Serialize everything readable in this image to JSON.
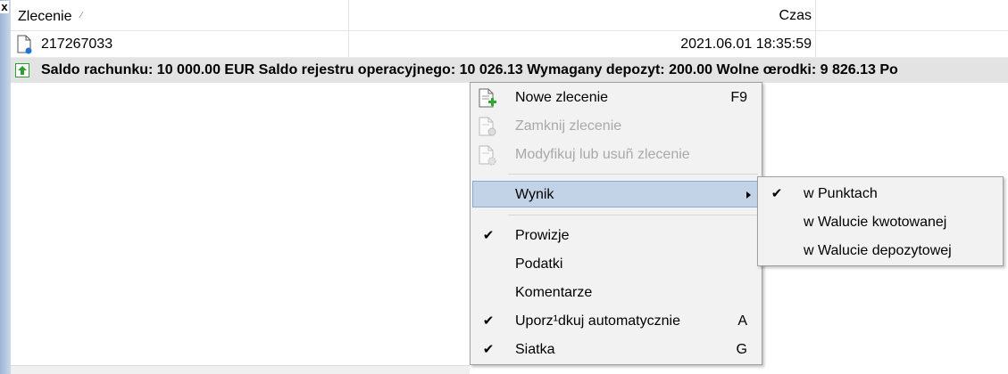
{
  "window": {
    "close_glyph": "x"
  },
  "table": {
    "columns": [
      {
        "label": "Zlecenie",
        "sort_indicator": "⁄"
      },
      {
        "label": "Czas"
      }
    ],
    "rows": [
      {
        "order": "217267033",
        "time": "2021.06.01 18:35:59",
        "icon": "order-document-icon"
      }
    ],
    "summary": {
      "icon": "green-up-arrow-icon",
      "text": "Saldo rachunku: 10 000.00 EUR  Saldo rejestru operacyjnego: 10 026.13  Wymagany depozyt: 200.00  Wolne œrodki: 9 826.13  Po"
    }
  },
  "context_menu": {
    "items": [
      {
        "label": "Nowe zlecenie",
        "shortcut": "F9",
        "icon": "new-order-icon",
        "enabled": true
      },
      {
        "label": "Zamknij zlecenie",
        "shortcut": "",
        "icon": "close-order-icon",
        "enabled": false
      },
      {
        "label": "Modyfikuj lub usuñ zlecenie",
        "shortcut": "",
        "icon": "modify-order-icon",
        "enabled": false
      },
      {
        "label": "Wynik",
        "shortcut": "",
        "submenu": true,
        "highlighted": true
      },
      {
        "label": "Prowizje",
        "checked": true
      },
      {
        "label": "Podatki",
        "checked": false
      },
      {
        "label": "Komentarze",
        "checked": false
      },
      {
        "label": "Uporz¹dkuj automatycznie",
        "shortcut": "A",
        "checked": true
      },
      {
        "label": "Siatka",
        "shortcut": "G",
        "checked": true
      }
    ],
    "check_glyph": "✔"
  },
  "submenu": {
    "items": [
      {
        "label": "w Punktach",
        "checked": true
      },
      {
        "label": "w Walucie kwotowanej",
        "checked": false
      },
      {
        "label": "w Walucie depozytowej",
        "checked": false
      }
    ]
  },
  "colors": {
    "highlight": "#c3d3e7",
    "summary_bg": "#e3e3e3",
    "accent_green": "#2e9e2e"
  }
}
